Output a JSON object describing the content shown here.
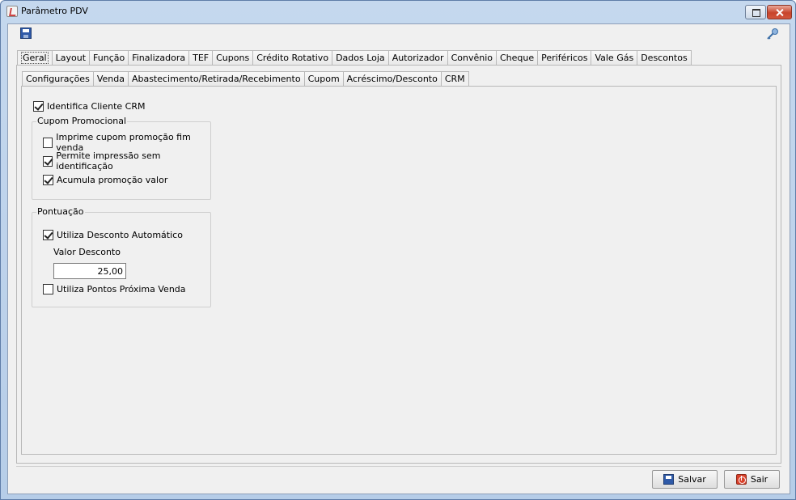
{
  "window": {
    "title": "Parâmetro PDV"
  },
  "toolbar": {
    "save_icon": "floppy-disk-icon",
    "key_icon": "key-icon"
  },
  "main_tabs": [
    {
      "label": "Geral",
      "active": true
    },
    {
      "label": "Layout",
      "active": false
    },
    {
      "label": "Função",
      "active": false
    },
    {
      "label": "Finalizadora",
      "active": false
    },
    {
      "label": "TEF",
      "active": false
    },
    {
      "label": "Cupons",
      "active": false
    },
    {
      "label": "Crédito Rotativo",
      "active": false
    },
    {
      "label": "Dados Loja",
      "active": false
    },
    {
      "label": "Autorizador",
      "active": false
    },
    {
      "label": "Convênio",
      "active": false
    },
    {
      "label": "Cheque",
      "active": false
    },
    {
      "label": "Periféricos",
      "active": false
    },
    {
      "label": "Vale Gás",
      "active": false
    },
    {
      "label": "Descontos",
      "active": false
    }
  ],
  "sub_tabs": [
    {
      "label": "Configurações",
      "active": false
    },
    {
      "label": "Venda",
      "active": false
    },
    {
      "label": "Abastecimento/Retirada/Recebimento",
      "active": false
    },
    {
      "label": "Cupom",
      "active": false
    },
    {
      "label": "Acréscimo/Desconto",
      "active": false
    },
    {
      "label": "CRM",
      "active": true
    }
  ],
  "crm": {
    "identifica_cliente": {
      "label": "Identifica Cliente CRM",
      "checked": true
    },
    "cupom_promocional": {
      "title": "Cupom Promocional",
      "imprime_cupom": {
        "label": "Imprime cupom promoção fim venda",
        "checked": false
      },
      "permite_impressao": {
        "label": "Permite impressão sem identificação",
        "checked": true
      },
      "acumula_promocao": {
        "label": "Acumula promoção valor",
        "checked": true
      }
    },
    "pontuacao": {
      "title": "Pontuação",
      "utiliza_desconto": {
        "label": "Utiliza Desconto Automático",
        "checked": true
      },
      "valor_desconto_label": "Valor Desconto",
      "valor_desconto_value": "25,00",
      "utiliza_pontos": {
        "label": "Utiliza Pontos Próxima Venda",
        "checked": false
      }
    }
  },
  "footer": {
    "save_label": "Salvar",
    "exit_label": "Sair"
  }
}
